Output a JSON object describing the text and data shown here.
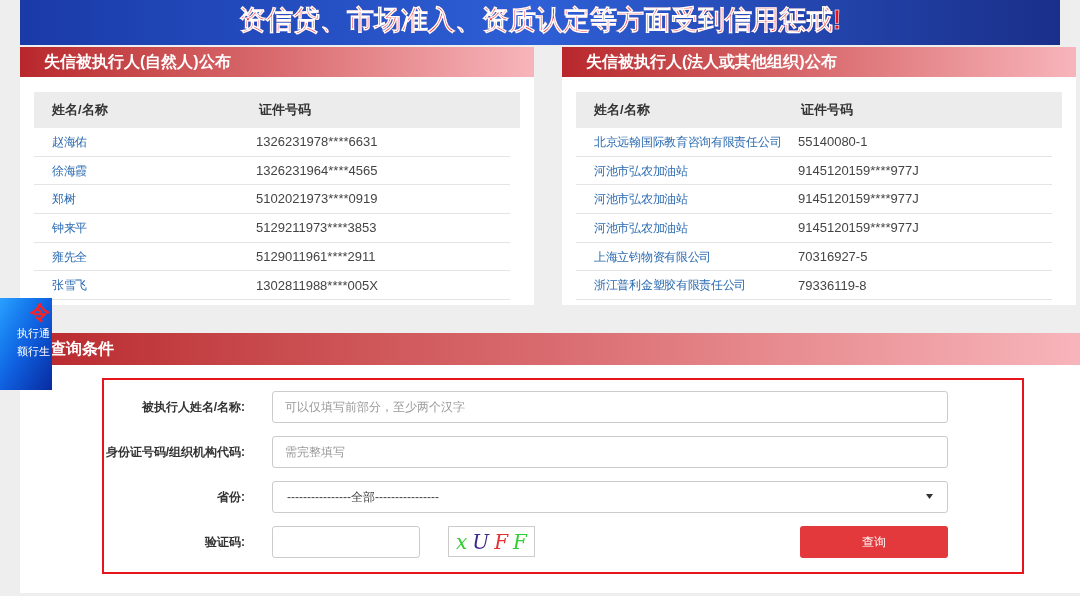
{
  "banner": {
    "text": "资信贷、市场准入、资质认定等方面受到信用惩戒!"
  },
  "panels": [
    {
      "title": "失信被执行人(自然人)公布",
      "columns": [
        "姓名/名称",
        "证件号码"
      ],
      "rows": [
        {
          "name": "赵海佑",
          "id": "1326231978****6631"
        },
        {
          "name": "徐海霞",
          "id": "1326231964****4565"
        },
        {
          "name": "郑树",
          "id": "5102021973****0919"
        },
        {
          "name": "钟来平",
          "id": "5129211973****3853"
        },
        {
          "name": "雍先全",
          "id": "5129011961****2911"
        },
        {
          "name": "张雪飞",
          "id": "1302811988****005X"
        }
      ]
    },
    {
      "title": "失信被执行人(法人或其他组织)公布",
      "columns": [
        "姓名/名称",
        "证件号码"
      ],
      "rows": [
        {
          "name": "北京远翰国际教育咨询有限责任公司",
          "id": "55140080-1"
        },
        {
          "name": "河池市弘农加油站",
          "id": "9145120159****977J"
        },
        {
          "name": "河池市弘农加油站",
          "id": "9145120159****977J"
        },
        {
          "name": "河池市弘农加油站",
          "id": "9145120159****977J"
        },
        {
          "name": "上海立钧物资有限公司",
          "id": "70316927-5"
        },
        {
          "name": "浙江普利金塑胶有限责任公司",
          "id": "79336119-8"
        }
      ]
    }
  ],
  "floating_ad": {
    "lines": [
      "令",
      "执行通",
      "额行生"
    ]
  },
  "query": {
    "title": "查询条件",
    "fields": [
      {
        "kind": "text",
        "label": "被执行人姓名/名称:",
        "placeholder": "可以仅填写前部分，至少两个汉字"
      },
      {
        "kind": "text",
        "label": "身份证号码/组织机构代码:",
        "placeholder": "需完整填写"
      },
      {
        "kind": "select",
        "label": "省份:",
        "value": "----------------全部----------------"
      }
    ],
    "captcha": {
      "label": "验证码:",
      "chars": [
        {
          "char": "x",
          "color": "#33cc33"
        },
        {
          "char": "U",
          "color": "#3b2a8c"
        },
        {
          "char": "F",
          "color": "#e53030"
        },
        {
          "char": "F",
          "color": "#33cc33"
        }
      ]
    },
    "button": "查询"
  }
}
